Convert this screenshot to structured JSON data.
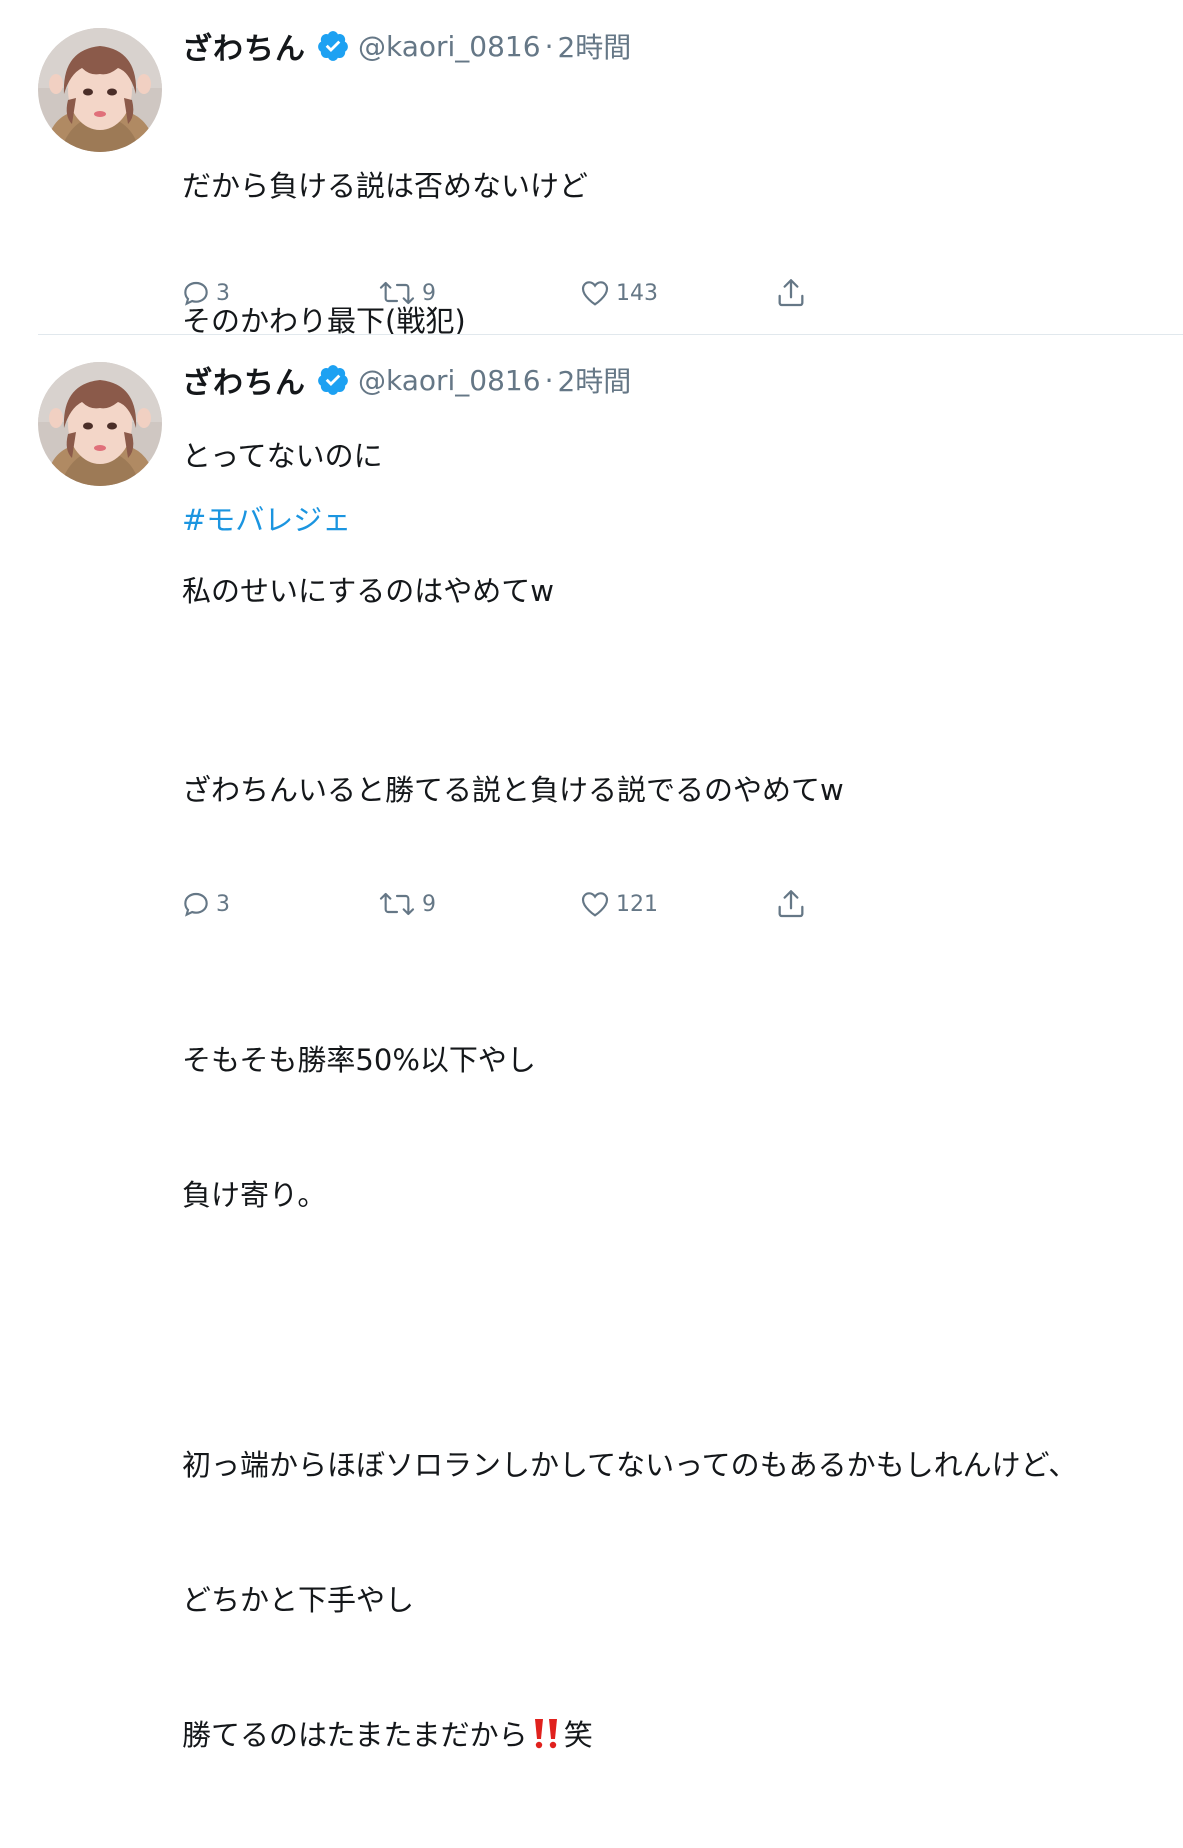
{
  "colors": {
    "verified": "#1da1f2",
    "hashtag": "#1b95e0",
    "secondary_text": "#657786",
    "divider": "#e1e8ed",
    "exclamation": "#e0211d"
  },
  "tweets": [
    {
      "author_name": "ざわちん",
      "handle": "@kaori_0816",
      "separator": "·",
      "time": "2時間",
      "lines": [
        "だから負ける説は否めないけど",
        "そのかわり最下(戦犯)",
        "とってないのに",
        "私のせいにするのはやめてw"
      ],
      "reply_count": "3",
      "retweet_count": "9",
      "like_count": "143"
    },
    {
      "author_name": "ざわちん",
      "handle": "@kaori_0816",
      "separator": "·",
      "time": "2時間",
      "hashtag": "#モバレジェ",
      "lines": [
        "",
        "ざわちんいると勝てる説と負ける説でるのやめてw",
        "",
        "そもそも勝率50%以下やし",
        "負け寄り。",
        "",
        "初っ端からほぼソロランしかしてないってのもあるかもしれんけど、",
        "どちかと下手やし"
      ],
      "last_line_before_emoji": "勝てるのはたまたまだから",
      "emoji_icon": "double-exclamation-icon",
      "last_line_after_emoji": "笑",
      "reply_count": "3",
      "retweet_count": "9",
      "like_count": "121"
    }
  ]
}
